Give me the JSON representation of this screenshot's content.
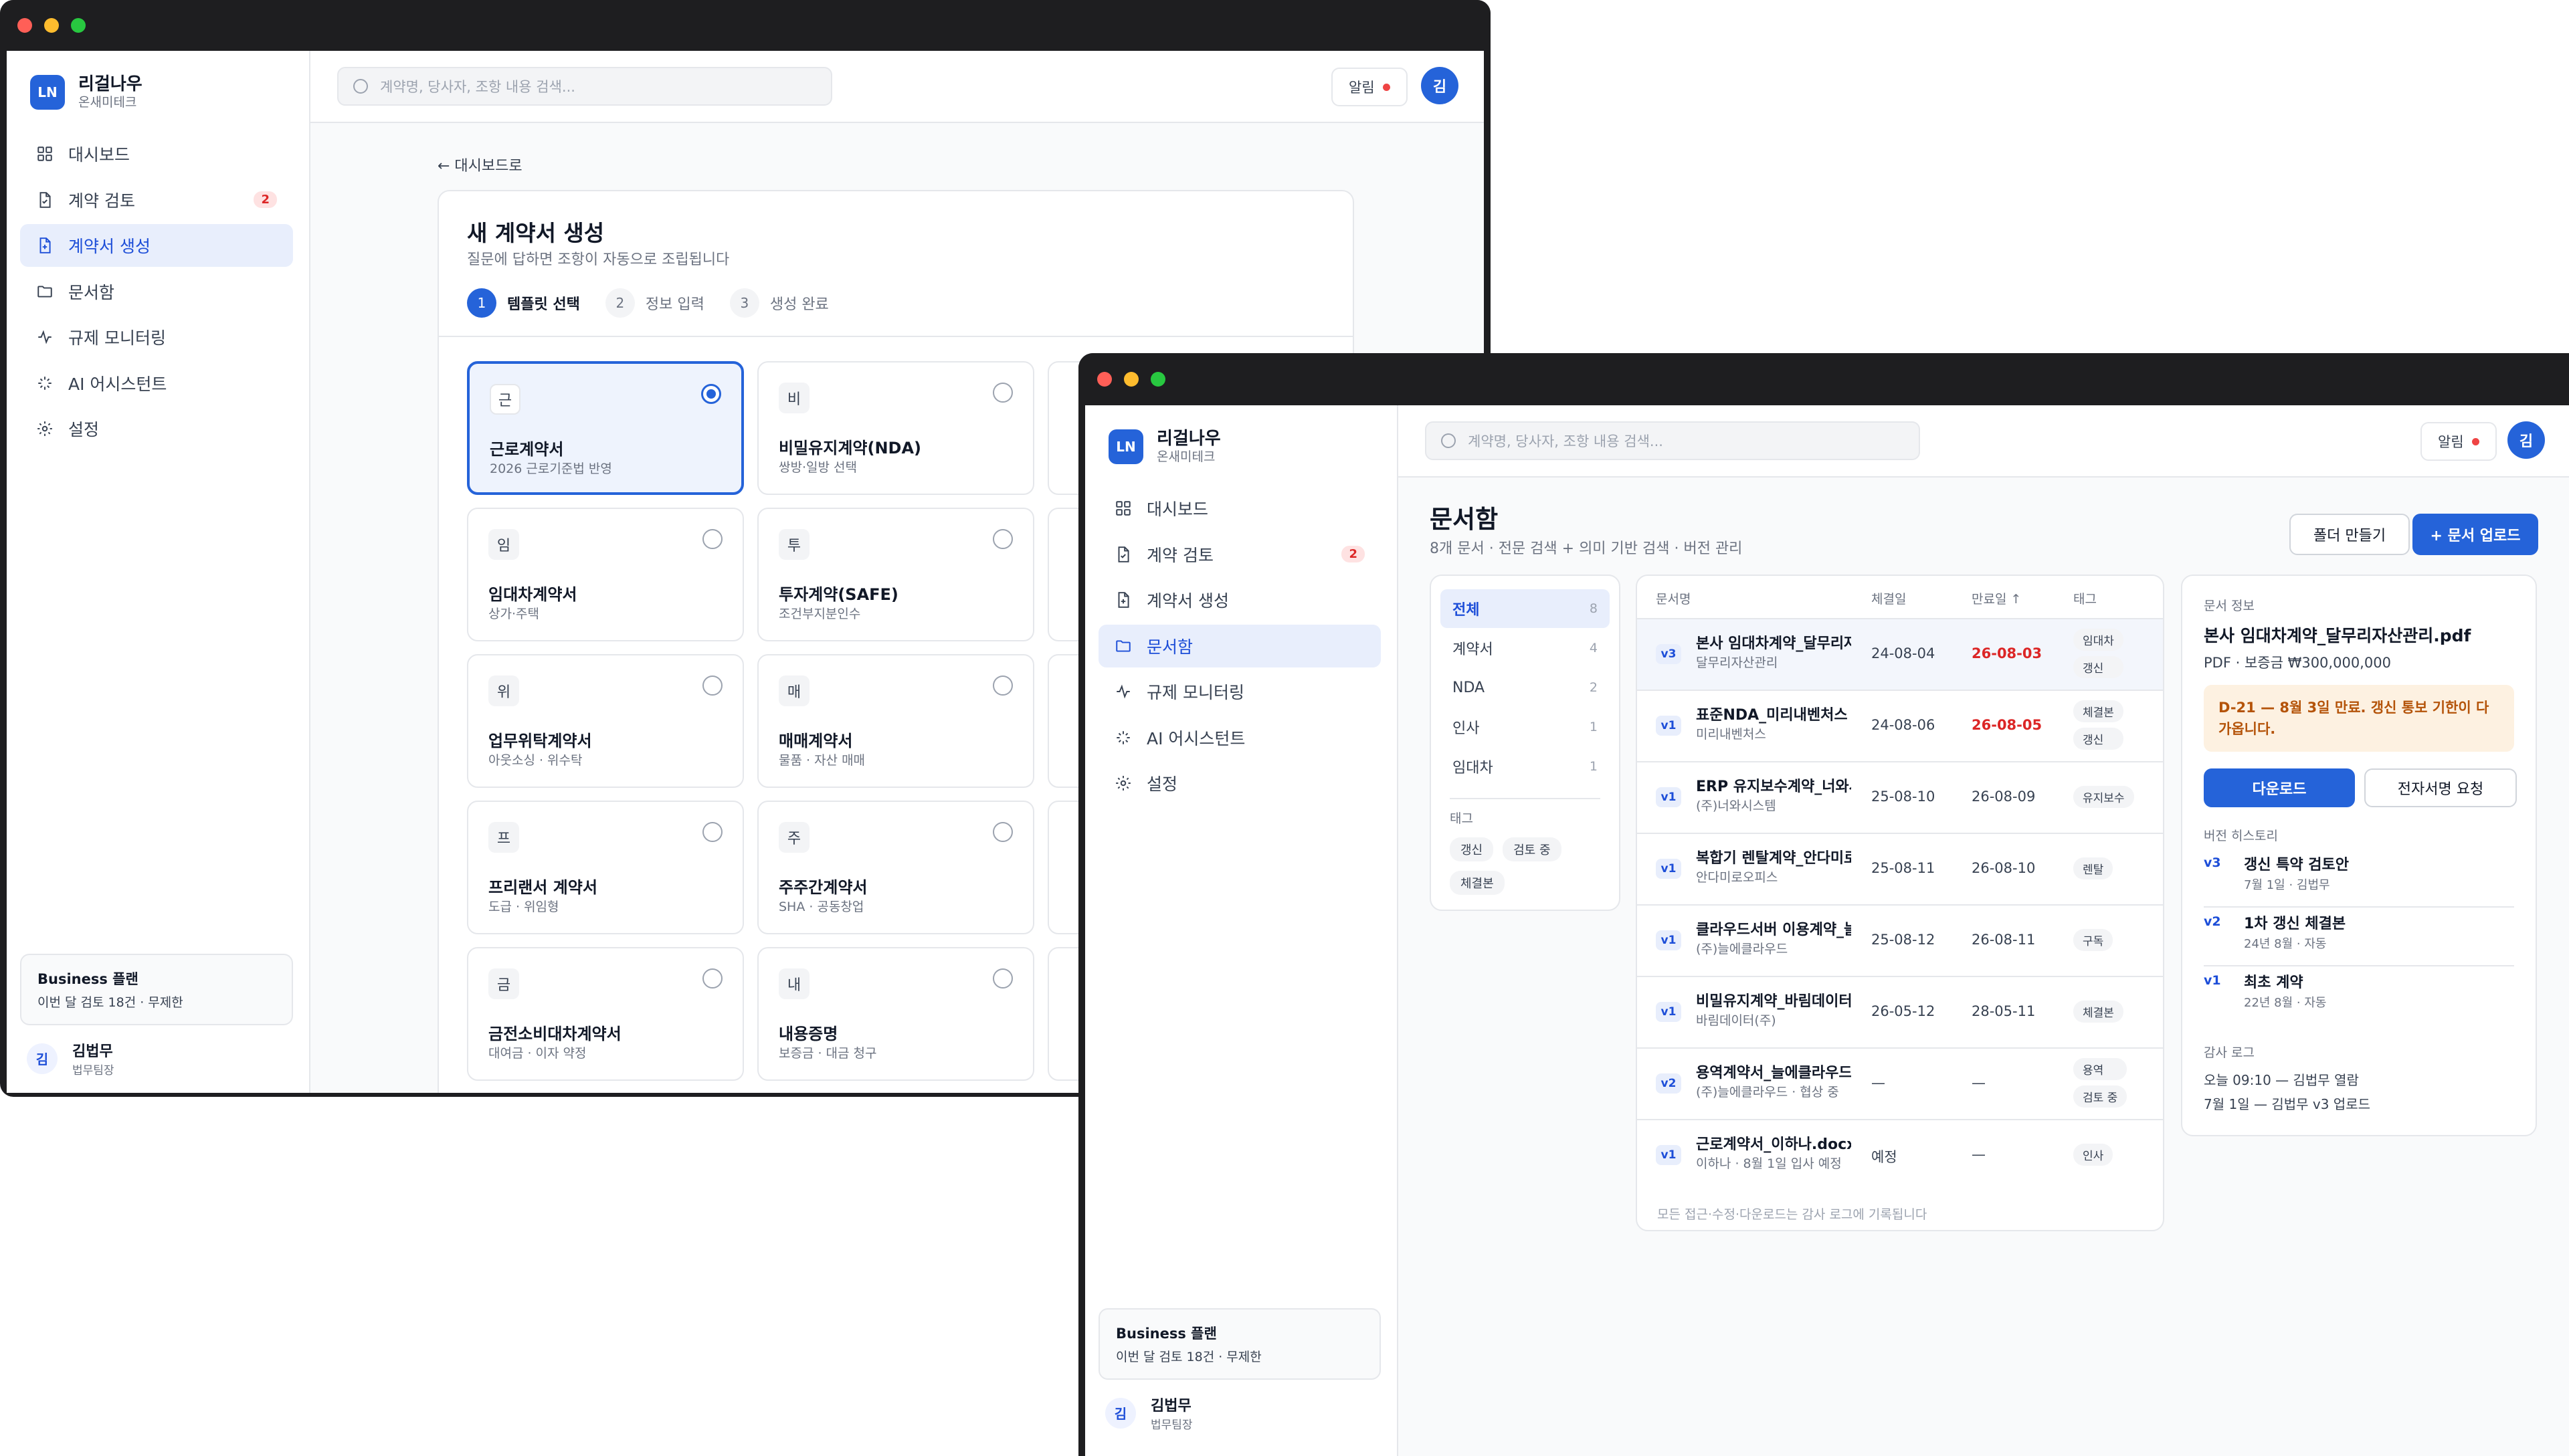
{
  "back_window": {
    "brand": {
      "logo": "LN",
      "name": "리걸나우",
      "company": "온새미테크"
    },
    "nav": [
      {
        "label": "대시보드",
        "icon": "dashboard-icon"
      },
      {
        "label": "계약 검토",
        "icon": "file-check-icon",
        "badge": "2"
      },
      {
        "label": "계약서 생성",
        "icon": "file-plus-icon",
        "active": true
      },
      {
        "label": "문서함",
        "icon": "folder-icon"
      },
      {
        "label": "규제 모니터링",
        "icon": "pulse-icon"
      },
      {
        "label": "AI 어시스턴트",
        "icon": "sparkle-icon"
      },
      {
        "label": "설정",
        "icon": "gear-icon"
      }
    ],
    "plan": {
      "title": "Business 플랜",
      "detail": "이번 달 검토 18건 · 무제한"
    },
    "user": {
      "initial": "김",
      "name": "김법무",
      "team": "법무팀장"
    },
    "search_placeholder": "계약명, 당사자, 조항 내용 검색...",
    "alert_label": "알림",
    "avatar": "김",
    "back_link": "← 대시보드로",
    "page_title": "새 계약서 생성",
    "page_sub": "질문에 답하면 조항이 자동으로 조립됩니다",
    "steps": [
      {
        "num": "1",
        "label": "템플릿 선택",
        "active": true
      },
      {
        "num": "2",
        "label": "정보 입력"
      },
      {
        "num": "3",
        "label": "생성 완료"
      }
    ],
    "templates": [
      {
        "mark": "근",
        "name": "근로계약서",
        "desc": "2026 근로기준법 반영",
        "selected": true
      },
      {
        "mark": "비",
        "name": "비밀유지계약(NDA)",
        "desc": "쌍방·일방 선택"
      },
      {
        "mark": "임",
        "name": "임대차계약서",
        "desc": "상가·주택"
      },
      {
        "mark": "투",
        "name": "투자계약(SAFE)",
        "desc": "조건부지분인수"
      },
      {
        "mark": "위",
        "name": "업무위탁계약서",
        "desc": "아웃소싱 · 위수탁"
      },
      {
        "mark": "매",
        "name": "매매계약서",
        "desc": "물품 · 자산 매매"
      },
      {
        "mark": "프",
        "name": "프리랜서 계약서",
        "desc": "도급 · 위임형"
      },
      {
        "mark": "주",
        "name": "주주간계약서",
        "desc": "SHA · 공동창업"
      },
      {
        "mark": "금",
        "name": "금전소비대차계약서",
        "desc": "대여금 · 이자 약정"
      },
      {
        "mark": "내",
        "name": "내용증명",
        "desc": "보증금 · 대금 청구"
      }
    ]
  },
  "front_window": {
    "brand": {
      "logo": "LN",
      "name": "리걸나우",
      "company": "온새미테크"
    },
    "nav": [
      {
        "label": "대시보드",
        "icon": "dashboard-icon"
      },
      {
        "label": "계약 검토",
        "icon": "file-check-icon",
        "badge": "2"
      },
      {
        "label": "계약서 생성",
        "icon": "file-plus-icon"
      },
      {
        "label": "문서함",
        "icon": "folder-icon",
        "active": true
      },
      {
        "label": "규제 모니터링",
        "icon": "pulse-icon"
      },
      {
        "label": "AI 어시스턴트",
        "icon": "sparkle-icon"
      },
      {
        "label": "설정",
        "icon": "gear-icon"
      }
    ],
    "plan": {
      "title": "Business 플랜",
      "detail": "이번 달 검토 18건 · 무제한"
    },
    "user": {
      "initial": "김",
      "name": "김법무",
      "team": "법무팀장"
    },
    "search_placeholder": "계약명, 당사자, 조항 내용 검색...",
    "alert_label": "알림",
    "avatar": "김",
    "page_title": "문서함",
    "page_sub": "8개 문서 · 전문 검색 + 의미 기반 검색 · 버전 관리",
    "btn_folder": "폴더 만들기",
    "btn_upload": "+ 문서 업로드",
    "folders": [
      {
        "label": "전체",
        "count": "8",
        "active": true
      },
      {
        "label": "계약서",
        "count": "4"
      },
      {
        "label": "NDA",
        "count": "2"
      },
      {
        "label": "인사",
        "count": "1"
      },
      {
        "label": "임대차",
        "count": "1"
      }
    ],
    "tags_header": "태그",
    "tags": [
      "갱신",
      "검토 중",
      "체결본"
    ],
    "table": {
      "headers": {
        "name": "문서명",
        "signed": "체결일",
        "expiry": "만료일 ↑",
        "tags": "태그"
      },
      "rows": [
        {
          "ver": "v3",
          "name": "본사 임대차계약_달무리자산관리",
          "party": "달무리자산관리",
          "signed": "24-08-04",
          "expiry": "26-08-03",
          "warn": true,
          "tags": [
            "임대차",
            "갱신"
          ]
        },
        {
          "ver": "v1",
          "name": "표준NDA_미리내벤처스",
          "party": "미리내벤처스",
          "signed": "24-08-06",
          "expiry": "26-08-05",
          "warn": true,
          "tags": [
            "체결본",
            "갱신"
          ]
        },
        {
          "ver": "v1",
          "name": "ERP 유지보수계약_너와시스템",
          "party": "(주)너와시스템",
          "signed": "25-08-10",
          "expiry": "26-08-09",
          "tags": [
            "유지보수"
          ]
        },
        {
          "ver": "v1",
          "name": "복합기 렌탈계약_안다미로오피스",
          "party": "안다미로오피스",
          "signed": "25-08-11",
          "expiry": "26-08-10",
          "tags": [
            "렌탈"
          ]
        },
        {
          "ver": "v1",
          "name": "클라우드서버 이용계약_늘에클라우드",
          "party": "(주)늘에클라우드",
          "signed": "25-08-12",
          "expiry": "26-08-11",
          "tags": [
            "구독"
          ]
        },
        {
          "ver": "v1",
          "name": "비밀유지계약_바림데이터",
          "party": "바림데이터(주)",
          "signed": "26-05-12",
          "expiry": "28-05-11",
          "tags": [
            "체결본"
          ]
        },
        {
          "ver": "v2",
          "name": "용역계약서_늘에클라우드",
          "party": "(주)늘에클라우드 · 협상 중",
          "signed": "—",
          "expiry": "—",
          "tags": [
            "용역",
            "검토 중"
          ]
        },
        {
          "ver": "v1",
          "name": "근로계약서_이하나.docx",
          "party": "이하나 · 8월 1일 입사 예정",
          "signed": "예정",
          "expiry": "—",
          "tags": [
            "인사"
          ]
        }
      ],
      "footer": "모든 접근·수정·다운로드는 감사 로그에 기록됩니다"
    },
    "info": {
      "label": "문서 정보",
      "file": "본사 임대차계약_달무리자산관리.pdf",
      "meta": "PDF · 보증금 ₩300,000,000",
      "notice": "D-21 — 8월 3일 만료. 갱신 통보 기한이 다가옵니다.",
      "btn_download": "다운로드",
      "btn_esign": "전자서명 요청",
      "history_label": "버전 히스토리",
      "history": [
        {
          "ver": "v3",
          "title": "갱신 특약 검토안",
          "sub": "7월 1일 · 김법무"
        },
        {
          "ver": "v2",
          "title": "1차 갱신 체결본",
          "sub": "24년 8월 · 자동"
        },
        {
          "ver": "v1",
          "title": "최초 계약",
          "sub": "22년 8월 · 자동"
        }
      ],
      "audit_label": "감사 로그",
      "audit": [
        "오늘 09:10 — 김법무 열람",
        "7월 1일 — 김법무 v3 업로드"
      ]
    }
  },
  "colors": {
    "accent": "#2563d9",
    "danger": "#dc2626",
    "notice_bg": "#fdf1e1",
    "titlebar": "#1e1e20"
  }
}
